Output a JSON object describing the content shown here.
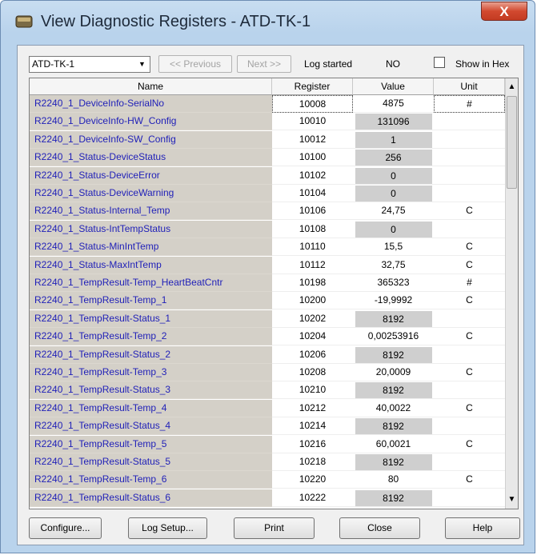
{
  "window": {
    "title": "View Diagnostic Registers - ATD-TK-1",
    "close_glyph": "X",
    "icon": "database-icon"
  },
  "toolbar": {
    "device_select": "ATD-TK-1",
    "previous_label": "<< Previous",
    "next_label": "Next >>",
    "log_started_label": "Log started",
    "log_started_value": "NO",
    "show_hex_label": "Show in Hex",
    "show_hex_checked": false
  },
  "table": {
    "headers": [
      "Name",
      "Register",
      "Value",
      "Unit"
    ],
    "rows": [
      {
        "name": "R2240_1_DeviceInfo-SerialNo",
        "register": "10008",
        "value": "4875",
        "unit": "#",
        "shaded": false
      },
      {
        "name": "R2240_1_DeviceInfo-HW_Config",
        "register": "10010",
        "value": "131096",
        "unit": "",
        "shaded": true
      },
      {
        "name": "R2240_1_DeviceInfo-SW_Config",
        "register": "10012",
        "value": "1",
        "unit": "",
        "shaded": true
      },
      {
        "name": "R2240_1_Status-DeviceStatus",
        "register": "10100",
        "value": "256",
        "unit": "",
        "shaded": true
      },
      {
        "name": "R2240_1_Status-DeviceError",
        "register": "10102",
        "value": "0",
        "unit": "",
        "shaded": true
      },
      {
        "name": "R2240_1_Status-DeviceWarning",
        "register": "10104",
        "value": "0",
        "unit": "",
        "shaded": true
      },
      {
        "name": "R2240_1_Status-Internal_Temp",
        "register": "10106",
        "value": "24,75",
        "unit": "C",
        "shaded": false
      },
      {
        "name": "R2240_1_Status-IntTempStatus",
        "register": "10108",
        "value": "0",
        "unit": "",
        "shaded": true
      },
      {
        "name": "R2240_1_Status-MinIntTemp",
        "register": "10110",
        "value": "15,5",
        "unit": "C",
        "shaded": false
      },
      {
        "name": "R2240_1_Status-MaxIntTemp",
        "register": "10112",
        "value": "32,75",
        "unit": "C",
        "shaded": false
      },
      {
        "name": "R2240_1_TempResult-Temp_HeartBeatCntr",
        "register": "10198",
        "value": "365323",
        "unit": "#",
        "shaded": false
      },
      {
        "name": "R2240_1_TempResult-Temp_1",
        "register": "10200",
        "value": "-19,9992",
        "unit": "C",
        "shaded": false
      },
      {
        "name": "R2240_1_TempResult-Status_1",
        "register": "10202",
        "value": "8192",
        "unit": "",
        "shaded": true
      },
      {
        "name": "R2240_1_TempResult-Temp_2",
        "register": "10204",
        "value": "0,00253916",
        "unit": "C",
        "shaded": false
      },
      {
        "name": "R2240_1_TempResult-Status_2",
        "register": "10206",
        "value": "8192",
        "unit": "",
        "shaded": true
      },
      {
        "name": "R2240_1_TempResult-Temp_3",
        "register": "10208",
        "value": "20,0009",
        "unit": "C",
        "shaded": false
      },
      {
        "name": "R2240_1_TempResult-Status_3",
        "register": "10210",
        "value": "8192",
        "unit": "",
        "shaded": true
      },
      {
        "name": "R2240_1_TempResult-Temp_4",
        "register": "10212",
        "value": "40,0022",
        "unit": "C",
        "shaded": false
      },
      {
        "name": "R2240_1_TempResult-Status_4",
        "register": "10214",
        "value": "8192",
        "unit": "",
        "shaded": true
      },
      {
        "name": "R2240_1_TempResult-Temp_5",
        "register": "10216",
        "value": "60,0021",
        "unit": "C",
        "shaded": false
      },
      {
        "name": "R2240_1_TempResult-Status_5",
        "register": "10218",
        "value": "8192",
        "unit": "",
        "shaded": true
      },
      {
        "name": "R2240_1_TempResult-Temp_6",
        "register": "10220",
        "value": "80",
        "unit": "C",
        "shaded": false
      },
      {
        "name": "R2240_1_TempResult-Status_6",
        "register": "10222",
        "value": "8192",
        "unit": "",
        "shaded": true
      }
    ]
  },
  "footer": {
    "configure_label": "Configure...",
    "log_setup_label": "Log Setup...",
    "print_label": "Print",
    "close_label": "Close",
    "help_label": "Help"
  },
  "colors": {
    "name_column_bg": "#d4d0c8",
    "name_text": "#1f1fb8",
    "shaded_value_bg": "#cfcfcf",
    "close_button": "#c9432a"
  }
}
